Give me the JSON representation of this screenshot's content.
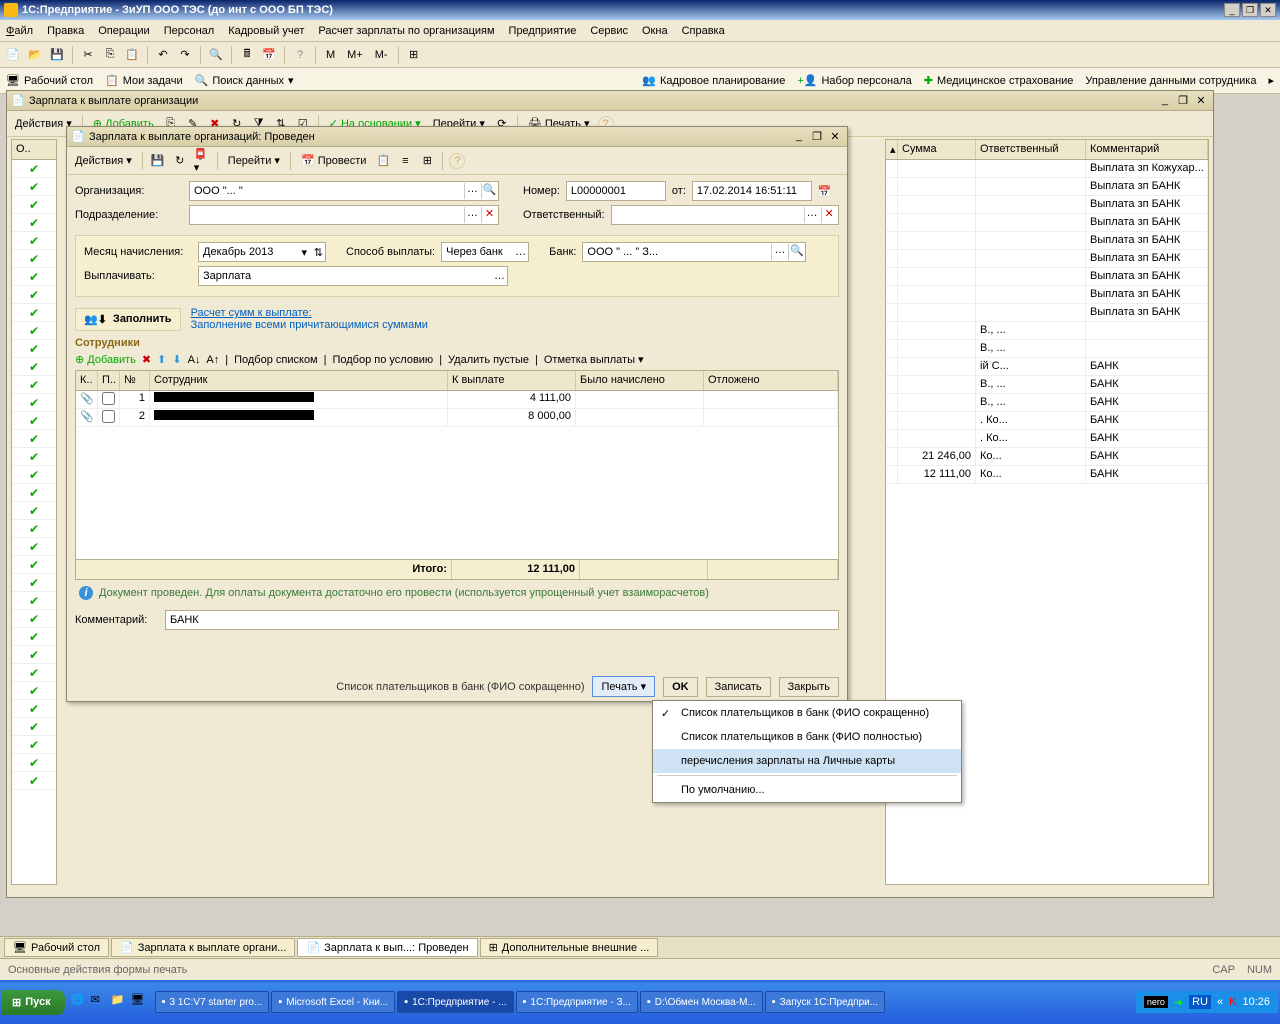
{
  "app": {
    "title": "1С:Предприятие - ЗиУП ООО ТЭС (до инт с ООО БП ТЭС)"
  },
  "menu": {
    "file": "Файл",
    "edit": "Правка",
    "ops": "Операции",
    "personnel": "Персонал",
    "kadr": "Кадровый учет",
    "calc": "Расчет зарплаты по организациям",
    "ent": "Предприятие",
    "service": "Сервис",
    "windows": "Окна",
    "help": "Справка"
  },
  "nav": {
    "desktop": "Рабочий стол",
    "tasks": "Мои задачи",
    "search": "Поиск данных",
    "kadr_plan": "Кадровое планирование",
    "nabor": "Набор персонала",
    "med": "Медицинское страхование",
    "upr": "Управление данными сотрудника"
  },
  "bgwin": {
    "title": "Зарплата к выплате организации",
    "actions": "Действия",
    "add": "Добавить",
    "basis": "На основании",
    "goto": "Перейти",
    "print": "Печать",
    "col_o": "О..",
    "col_sum": "Сумма",
    "col_resp": "Ответственный",
    "col_comment": "Комментарий",
    "rows": [
      {
        "comment": "Выплата зп Кожухар..."
      },
      {
        "comment": "Выплата зп БАНК"
      },
      {
        "comment": "Выплата зп БАНК"
      },
      {
        "comment": "Выплата зп БАНК"
      },
      {
        "comment": "Выплата зп БАНК"
      },
      {
        "comment": "Выплата зп БАНК"
      },
      {
        "comment": "Выплата зп БАНК"
      },
      {
        "comment": "Выплата зп БАНК"
      },
      {
        "comment": "Выплата зп БАНК"
      },
      {
        "resp": "В., ..."
      },
      {
        "resp": "В., ..."
      },
      {
        "resp": "ій С...",
        "comment": "БАНК"
      },
      {
        "resp": "В., ...",
        "comment": "БАНК"
      },
      {
        "resp": "В., ...",
        "comment": "БАНК"
      },
      {
        "resp": ". Ко...",
        "comment": "БАНК"
      },
      {
        "resp": ". Ко...",
        "comment": "БАНК"
      },
      {
        "sum": "21 246,00",
        "resp": "Ко...",
        "comment": "БАНК"
      },
      {
        "sum": "12 111,00",
        "resp": "Ко...",
        "comment": "БАНК"
      }
    ]
  },
  "dlg": {
    "title": "Зарплата к выплате организаций: Проведен",
    "actions": "Действия",
    "goto": "Перейти",
    "provesti": "Провести",
    "org_label": "Организация:",
    "org_value": "ООО \"...                    \"",
    "num_label": "Номер:",
    "num_value": "L00000001",
    "from_label": "от:",
    "from_value": "17.02.2014 16:51:11",
    "dept_label": "Подразделение:",
    "dept_value": "",
    "resp_label": "Ответственный:",
    "resp_value": "",
    "month_label": "Месяц начисления:",
    "month_value": "Декабрь 2013",
    "method_label": "Способ выплаты:",
    "method_value": "Через банк",
    "bank_label": "Банк:",
    "bank_value": "ООО \" ...                          \" З...",
    "pay_label": "Выплачивать:",
    "pay_value": "Зарплата",
    "fill_btn": "Заполнить",
    "link1": "Расчет сумм к выплате:",
    "link2": "Заполнение всеми причитающимися суммами",
    "section": "Сотрудники",
    "tb_add": "Добавить",
    "tb_list": "Подбор списком",
    "tb_cond": "Подбор по условию",
    "tb_del": "Удалить пустые",
    "tb_mark": "Отметка выплаты",
    "col_k": "К..",
    "col_p": "П..",
    "col_n": "№",
    "col_emp": "Сотрудник",
    "col_pay": "К выплате",
    "col_accr": "Было начислено",
    "col_def": "Отложено",
    "rows": [
      {
        "n": "1",
        "emp": "...",
        "pay": "4 111,00"
      },
      {
        "n": "2",
        "emp": "...",
        "pay": "8 000,00"
      }
    ],
    "total_label": "Итого:",
    "total_value": "12 111,00",
    "info": "Документ проведен. Для оплаты документа достаточно его провести (используется упрощенный учет взаиморасчетов)",
    "comment_label": "Комментарий:",
    "comment_value": "БАНК",
    "footer_list": "Список плательщиков в банк (ФИО сокращенно)",
    "footer_print": "Печать",
    "footer_ok": "OK",
    "footer_save": "Записать",
    "footer_close": "Закрыть"
  },
  "menu_popup": {
    "item1": "Список плательщиков в банк (ФИО сокращенно)",
    "item2": "Список плательщиков в банк (ФИО полностью)",
    "item3": "перечисления зарплаты на Личные карты",
    "item4": "По умолчанию..."
  },
  "wtabs": {
    "desktop": "Рабочий стол",
    "t1": "Зарплата к выплате органи...",
    "t2": "Зарплата к вып...: Проведен",
    "t3": "Дополнительные внешние ..."
  },
  "status": {
    "text": "Основные действия формы печать",
    "cap": "CAP",
    "num": "NUM"
  },
  "taskbar": {
    "start": "Пуск",
    "tasks": [
      "3 1C:V7 starter pro...",
      "Microsoft Excel - Кни...",
      "1С:Предприятие - ...",
      "1С:Предприятие - З...",
      "D:\\Обмен Москва-М...",
      "Запуск 1С:Предпри..."
    ],
    "lang": "RU",
    "time": "10:26"
  }
}
